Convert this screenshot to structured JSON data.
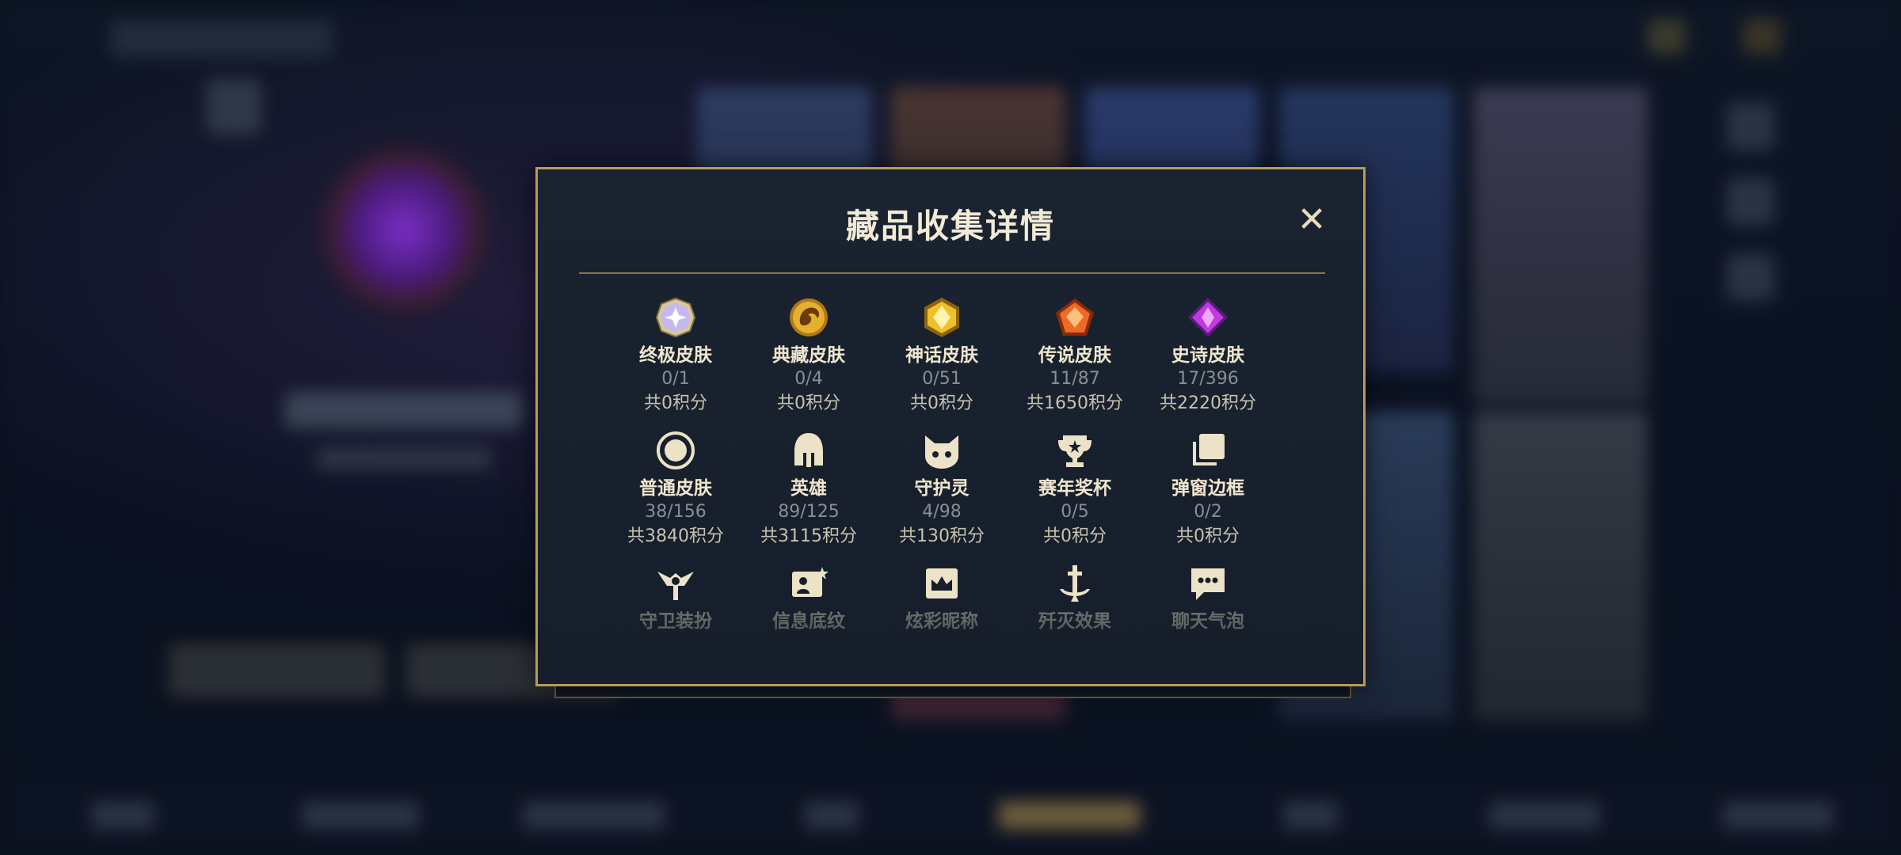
{
  "modal": {
    "title": "藏品收集详情",
    "close_symbol": "✕",
    "items": [
      {
        "name": "终极皮肤",
        "count": "0/1",
        "points": "共0积分",
        "icon": "ultimate-skin-icon",
        "color": "#b7a9f2"
      },
      {
        "name": "典藏皮肤",
        "count": "0/4",
        "points": "共0积分",
        "icon": "dragon-collection-icon",
        "color": "#d9a52a"
      },
      {
        "name": "神话皮肤",
        "count": "0/51",
        "points": "共0积分",
        "icon": "mythic-skin-icon",
        "color": "#e3b21c"
      },
      {
        "name": "传说皮肤",
        "count": "11/87",
        "points": "共1650积分",
        "icon": "legendary-skin-icon",
        "color": "#e0602a"
      },
      {
        "name": "史诗皮肤",
        "count": "17/396",
        "points": "共2220积分",
        "icon": "epic-skin-icon",
        "color": "#b22fd6"
      },
      {
        "name": "普通皮肤",
        "count": "38/156",
        "points": "共3840积分",
        "icon": "normal-skin-icon",
        "color": "#e8dcc0"
      },
      {
        "name": "英雄",
        "count": "89/125",
        "points": "共3115积分",
        "icon": "helmet-icon",
        "color": "#e8dcc0"
      },
      {
        "name": "守护灵",
        "count": "4/98",
        "points": "共130积分",
        "icon": "guardian-pet-icon",
        "color": "#e8dcc0"
      },
      {
        "name": "赛年奖杯",
        "count": "0/5",
        "points": "共0积分",
        "icon": "trophy-icon",
        "color": "#e8dcc0"
      },
      {
        "name": "弹窗边框",
        "count": "0/2",
        "points": "共0积分",
        "icon": "popup-frame-icon",
        "color": "#e8dcc0"
      },
      {
        "name": "守卫装扮",
        "count": "",
        "points": "",
        "icon": "ward-skin-icon",
        "color": "#e8dcc0"
      },
      {
        "name": "信息底纹",
        "count": "",
        "points": "",
        "icon": "info-banner-icon",
        "color": "#e8dcc0"
      },
      {
        "name": "炫彩昵称",
        "count": "",
        "points": "",
        "icon": "colorful-nickname-icon",
        "color": "#e8dcc0"
      },
      {
        "name": "歼灭效果",
        "count": "",
        "points": "",
        "icon": "kill-effect-icon",
        "color": "#e8dcc0"
      },
      {
        "name": "聊天气泡",
        "count": "",
        "points": "",
        "icon": "chat-bubble-icon",
        "color": "#e8dcc0"
      }
    ]
  },
  "colors": {
    "gold_border": "#b99a5a",
    "title": "#f2ead6",
    "muted": "#8a8d93"
  }
}
